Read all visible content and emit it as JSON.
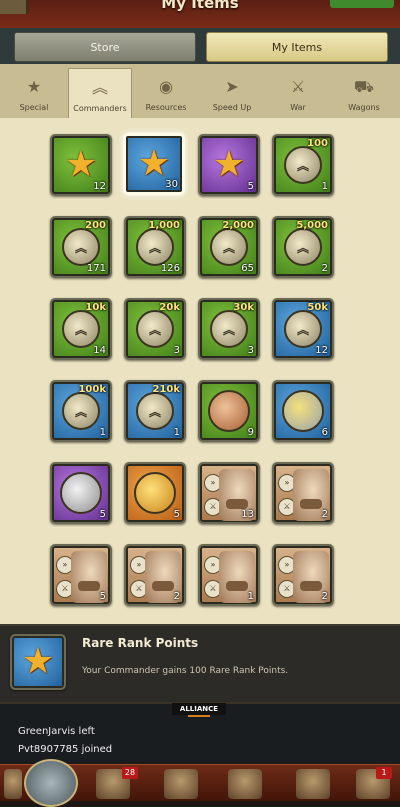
{
  "header": {
    "title": "My Items"
  },
  "tabs": {
    "store": "Store",
    "my_items": "My Items"
  },
  "categories": [
    {
      "label": "Special",
      "icon": "star-icon"
    },
    {
      "label": "Commanders",
      "icon": "rank-chevron-icon"
    },
    {
      "label": "Resources",
      "icon": "resources-icon"
    },
    {
      "label": "Speed Up",
      "icon": "speed-arrow-icon"
    },
    {
      "label": "War",
      "icon": "crossed-swords-icon"
    },
    {
      "label": "Wagons",
      "icon": "wagon-icon"
    }
  ],
  "items": [
    {
      "type": "star",
      "bg": "green",
      "count": "12",
      "amount": "",
      "selected": false
    },
    {
      "type": "star",
      "bg": "blue",
      "count": "30",
      "amount": "",
      "selected": true
    },
    {
      "type": "star",
      "bg": "purple",
      "count": "5",
      "amount": "",
      "selected": false
    },
    {
      "type": "rank",
      "bg": "green",
      "count": "1",
      "amount": "100",
      "selected": false
    },
    {
      "type": "rank",
      "bg": "green",
      "count": "171",
      "amount": "200",
      "selected": false
    },
    {
      "type": "rank",
      "bg": "green",
      "count": "126",
      "amount": "1,000",
      "selected": false
    },
    {
      "type": "rank",
      "bg": "green",
      "count": "65",
      "amount": "2,000",
      "selected": false
    },
    {
      "type": "rank",
      "bg": "green",
      "count": "2",
      "amount": "5,000",
      "selected": false
    },
    {
      "type": "rank",
      "bg": "green",
      "count": "14",
      "amount": "10k",
      "selected": false
    },
    {
      "type": "rank",
      "bg": "green",
      "count": "3",
      "amount": "20k",
      "selected": false
    },
    {
      "type": "rank",
      "bg": "green",
      "count": "3",
      "amount": "30k",
      "selected": false
    },
    {
      "type": "rank",
      "bg": "blue",
      "count": "12",
      "amount": "50k",
      "selected": false
    },
    {
      "type": "rank",
      "bg": "blue",
      "count": "1",
      "amount": "100k",
      "selected": false
    },
    {
      "type": "rank",
      "bg": "blue",
      "count": "1",
      "amount": "210k",
      "selected": false
    },
    {
      "type": "disc",
      "bg": "green",
      "count": "9",
      "amount": "",
      "disc": "bronze",
      "selected": false
    },
    {
      "type": "disc",
      "bg": "blue",
      "count": "6",
      "amount": "",
      "disc": "goldsilver",
      "selected": false
    },
    {
      "type": "disc",
      "bg": "purple",
      "count": "5",
      "amount": "",
      "disc": "silver",
      "selected": false
    },
    {
      "type": "disc",
      "bg": "orange",
      "count": "5",
      "amount": "",
      "disc": "gold",
      "selected": false
    },
    {
      "type": "portrait",
      "bg": "sepia",
      "count": "13",
      "amount": "",
      "selected": false
    },
    {
      "type": "portrait",
      "bg": "sepia",
      "count": "2",
      "amount": "",
      "selected": false
    },
    {
      "type": "portrait",
      "bg": "sepia",
      "count": "5",
      "amount": "",
      "selected": false
    },
    {
      "type": "portrait",
      "bg": "sepia",
      "count": "2",
      "amount": "",
      "selected": false
    },
    {
      "type": "portrait",
      "bg": "sepia",
      "count": "1",
      "amount": "",
      "selected": false
    },
    {
      "type": "portrait",
      "bg": "sepia",
      "count": "2",
      "amount": "",
      "selected": false
    }
  ],
  "details": {
    "name": "Rare Rank Points",
    "description": "Your Commander gains 100 Rare Rank Points."
  },
  "chat": {
    "channel": "ALLIANCE",
    "messages": [
      "GreenJarvis left",
      "Pvt8907785 joined"
    ]
  },
  "bottom_nav": [
    {
      "icon": "town-icon",
      "badge": ""
    },
    {
      "icon": "commander-icon",
      "badge": "28"
    },
    {
      "icon": "alliance-flag-icon",
      "badge": ""
    },
    {
      "icon": "building-icon",
      "badge": ""
    },
    {
      "icon": "mail-icon",
      "badge": ""
    },
    {
      "icon": "eagle-icon",
      "badge": "1"
    }
  ],
  "colors": {
    "green": "#4f9020",
    "blue": "#2a74b6",
    "purple": "#7a3fae",
    "orange": "#d7781e",
    "gold_text": "#ffe47a"
  }
}
